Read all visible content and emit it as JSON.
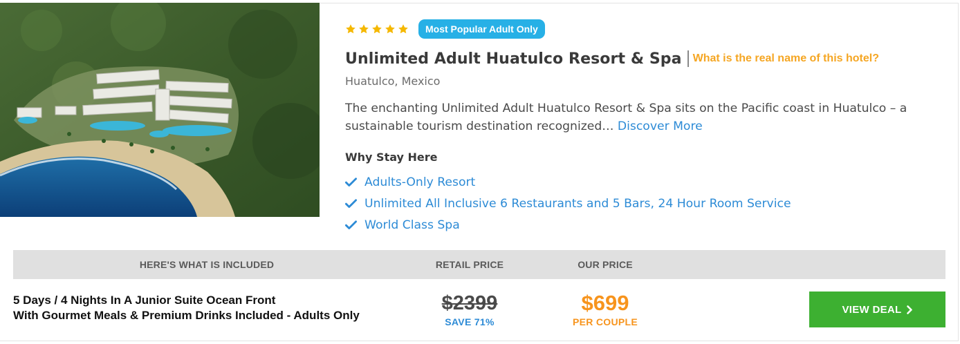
{
  "listing": {
    "rating_stars": 5,
    "badge": "Most Popular Adult Only",
    "hotel_name": "Unlimited Adult Huatulco Resort & Spa",
    "real_name_link": "What is the real name of this hotel?",
    "location": "Huatulco, Mexico",
    "description": "The enchanting Unlimited Adult Huatulco Resort & Spa sits on the Pacific coast in Huatulco – a sustainable tourism destination recognized…",
    "discover_more": "Discover More",
    "why_title": "Why Stay Here",
    "features": [
      "Adults-Only Resort",
      "Unlimited All Inclusive 6 Restaurants and 5 Bars, 24 Hour Room Service",
      "World Class Spa"
    ]
  },
  "pricing": {
    "headers": {
      "included": "HERE'S WHAT IS INCLUDED",
      "retail": "RETAIL PRICE",
      "ours": "OUR PRICE"
    },
    "package_line1": "5 Days / 4 Nights In A Junior Suite Ocean Front",
    "package_line2": "With Gourmet Meals & Premium Drinks Included - Adults Only",
    "retail_price": "$2399",
    "save_text": "SAVE 71%",
    "our_price": "$699",
    "per_text": "PER COUPLE",
    "cta_label": "VIEW DEAL",
    "cta_icon": "chevron-right-icon"
  },
  "colors": {
    "badge": "#27b0e6",
    "star": "#f5b800",
    "link_orange": "#f5a623",
    "link_blue": "#2d8bd6",
    "price_orange": "#f7941d",
    "cta_green": "#3db031",
    "header_gray": "#e0e0e0"
  }
}
